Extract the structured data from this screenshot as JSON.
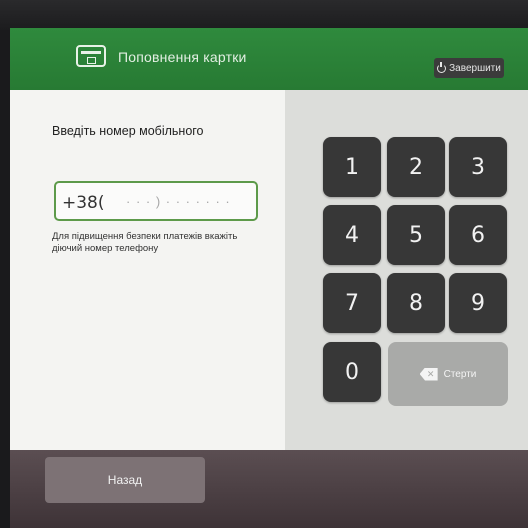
{
  "header": {
    "title": "Поповнення картки",
    "finish_label": "Завершити",
    "card_icon": "card-icon",
    "power_icon": "power-icon"
  },
  "form": {
    "prompt": "Введіть номер мобільного",
    "phone_value": "+38(",
    "phone_mask": "· · · ) · · ·  · ·  · ·",
    "hint": "Для підвищення безпеки платежів вкажіть діючий номер телефону"
  },
  "keypad": {
    "keys": [
      "1",
      "2",
      "3",
      "4",
      "5",
      "6",
      "7",
      "8",
      "9",
      "0"
    ],
    "erase_label": "Стерти",
    "erase_icon": "backspace-icon"
  },
  "footer": {
    "back_label": "Назад"
  },
  "colors": {
    "header_green": "#2f8a3d",
    "field_border": "#5d9a4a",
    "key_dark": "#373737",
    "key_erase": "#a9aaa8"
  }
}
